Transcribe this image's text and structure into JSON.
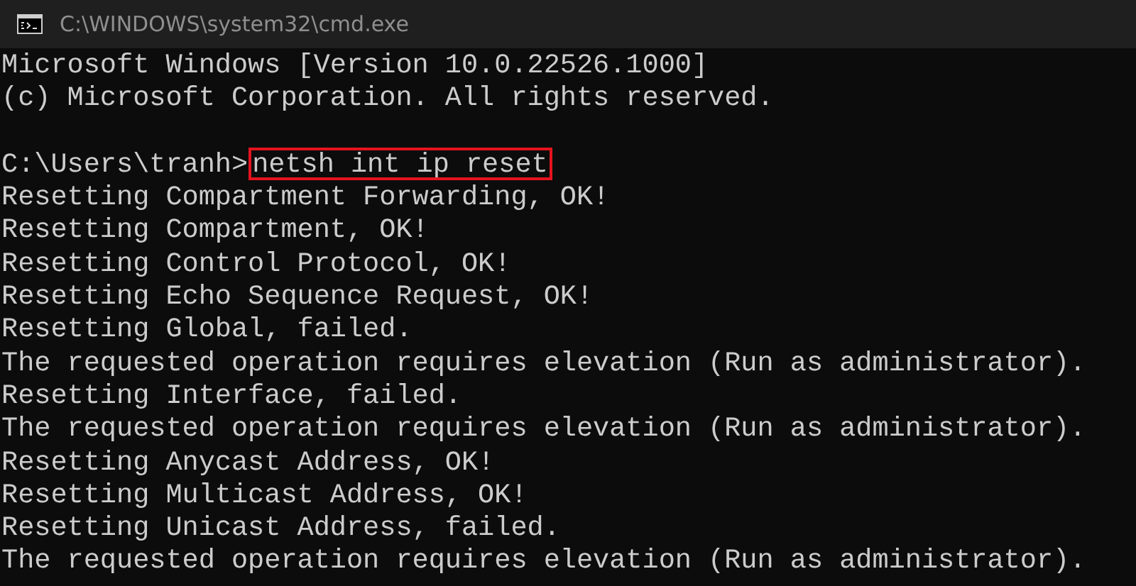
{
  "window": {
    "title": "C:\\WINDOWS\\system32\\cmd.exe"
  },
  "console": {
    "lines": [
      {
        "kind": "output",
        "text": "Microsoft Windows [Version 10.0.22526.1000]"
      },
      {
        "kind": "output",
        "text": "(c) Microsoft Corporation. All rights reserved."
      },
      {
        "kind": "blank"
      },
      {
        "kind": "prompt",
        "prompt": "C:\\Users\\tranh>",
        "command": "netsh int ip reset",
        "highlighted": true
      },
      {
        "kind": "output",
        "text": "Resetting Compartment Forwarding, OK!"
      },
      {
        "kind": "output",
        "text": "Resetting Compartment, OK!"
      },
      {
        "kind": "output",
        "text": "Resetting Control Protocol, OK!"
      },
      {
        "kind": "output",
        "text": "Resetting Echo Sequence Request, OK!"
      },
      {
        "kind": "output",
        "text": "Resetting Global, failed."
      },
      {
        "kind": "output",
        "text": "The requested operation requires elevation (Run as administrator)."
      },
      {
        "kind": "output",
        "text": "Resetting Interface, failed."
      },
      {
        "kind": "output",
        "text": "The requested operation requires elevation (Run as administrator)."
      },
      {
        "kind": "output",
        "text": "Resetting Anycast Address, OK!"
      },
      {
        "kind": "output",
        "text": "Resetting Multicast Address, OK!"
      },
      {
        "kind": "output",
        "text": "Resetting Unicast Address, failed."
      },
      {
        "kind": "output",
        "text": "The requested operation requires elevation (Run as administrator)."
      }
    ]
  }
}
